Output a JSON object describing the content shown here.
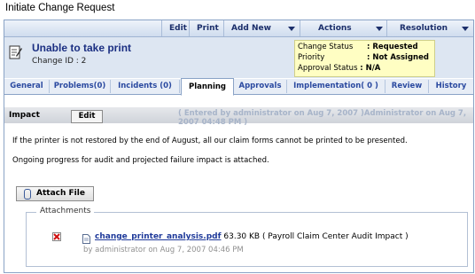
{
  "page_title": "Initiate Change Request",
  "toolbar": {
    "edit": "Edit",
    "print": "Print",
    "add_new": "Add New",
    "actions": "Actions",
    "resolution": "Resolution"
  },
  "request": {
    "title": "Unable to take print",
    "change_id": "Change ID : 2"
  },
  "status": {
    "change_status_label": "Change Status",
    "change_status_value": ": Requested",
    "priority_label": "Priority",
    "priority_value": ": Not Assigned",
    "approval_label": "Approval Status",
    "approval_value": ": N/A"
  },
  "tabs": [
    "General",
    "Problems(0)",
    "Incidents (0)",
    "Planning",
    "Approvals",
    "Implementation( 0 )",
    "Review",
    "History"
  ],
  "impact": {
    "label": "Impact",
    "edit_label": "Edit",
    "entered_by": "( Entered by administrator on Aug 7, 2007 )Administrator on Aug 7, 2007 04:48 PM )",
    "line1": "If the printer is not restored by the end of August, all our claim forms cannot be printed to be presented.",
    "line2": "Ongoing progress for audit and projected failure impact is attached."
  },
  "attach_button": "Attach File",
  "attachments": {
    "legend": "Attachments",
    "file_name": "change_printer_analysis.pdf",
    "file_info": " 63.30 KB ( Payroll Claim Center Audit Impact )",
    "meta": "by administrator on Aug 7, 2007 04:46 PM"
  }
}
